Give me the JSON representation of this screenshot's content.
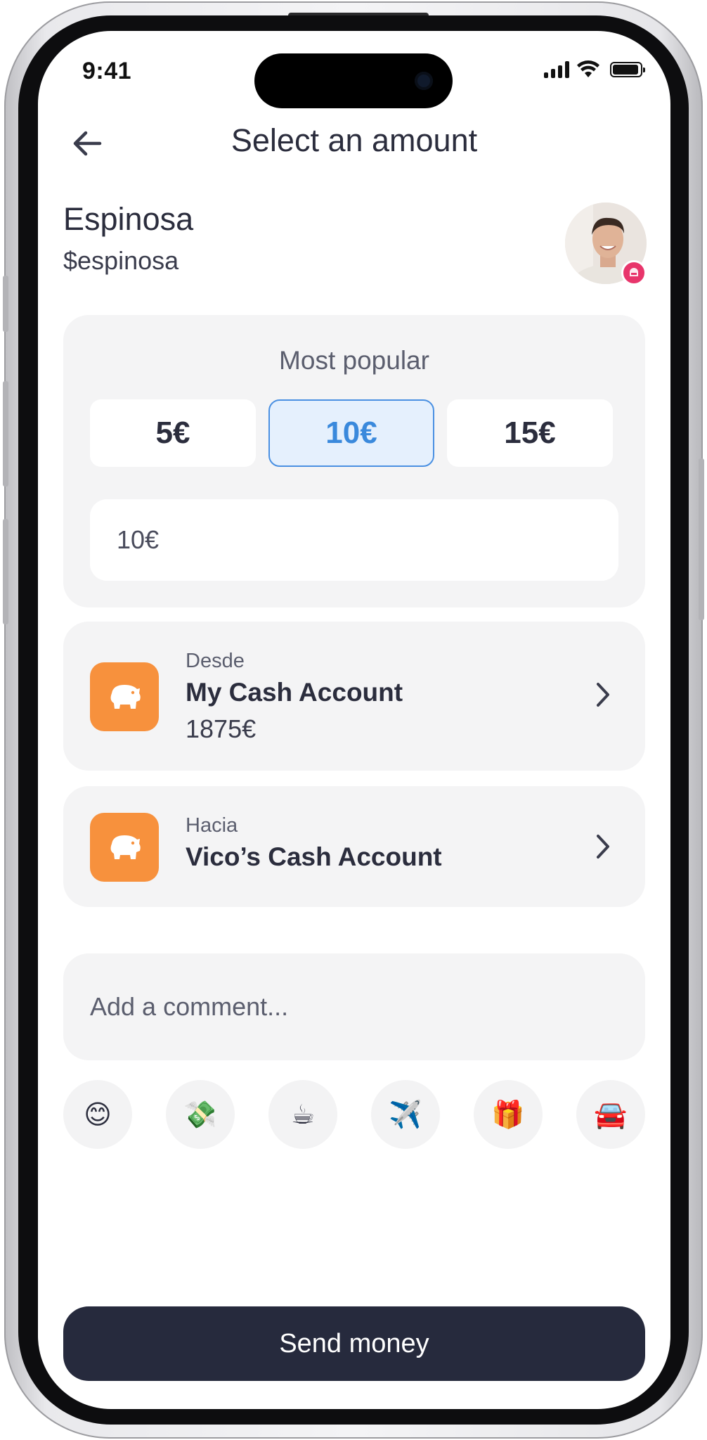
{
  "status_bar": {
    "time": "9:41"
  },
  "header": {
    "title": "Select an amount"
  },
  "recipient": {
    "name": "Espinosa",
    "handle": "$espinosa"
  },
  "popular": {
    "title": "Most popular",
    "amounts": [
      "5€",
      "10€",
      "15€"
    ],
    "selected_index": 1,
    "input_value": "10€"
  },
  "from_account": {
    "label": "Desde",
    "name": "My Cash Account",
    "balance": "1875€"
  },
  "to_account": {
    "label": "Hacia",
    "name": "Vico’s Cash Account"
  },
  "comment": {
    "placeholder": "Add a comment..."
  },
  "emojis": [
    "😊",
    "💸",
    "☕",
    "✈️",
    "🎁",
    "🚘"
  ],
  "send_button": {
    "label": "Send money"
  },
  "colors": {
    "accent": "#3a89dc",
    "account_icon": "#f7913d",
    "send_button": "#262a3d",
    "badge": "#e8356b"
  }
}
